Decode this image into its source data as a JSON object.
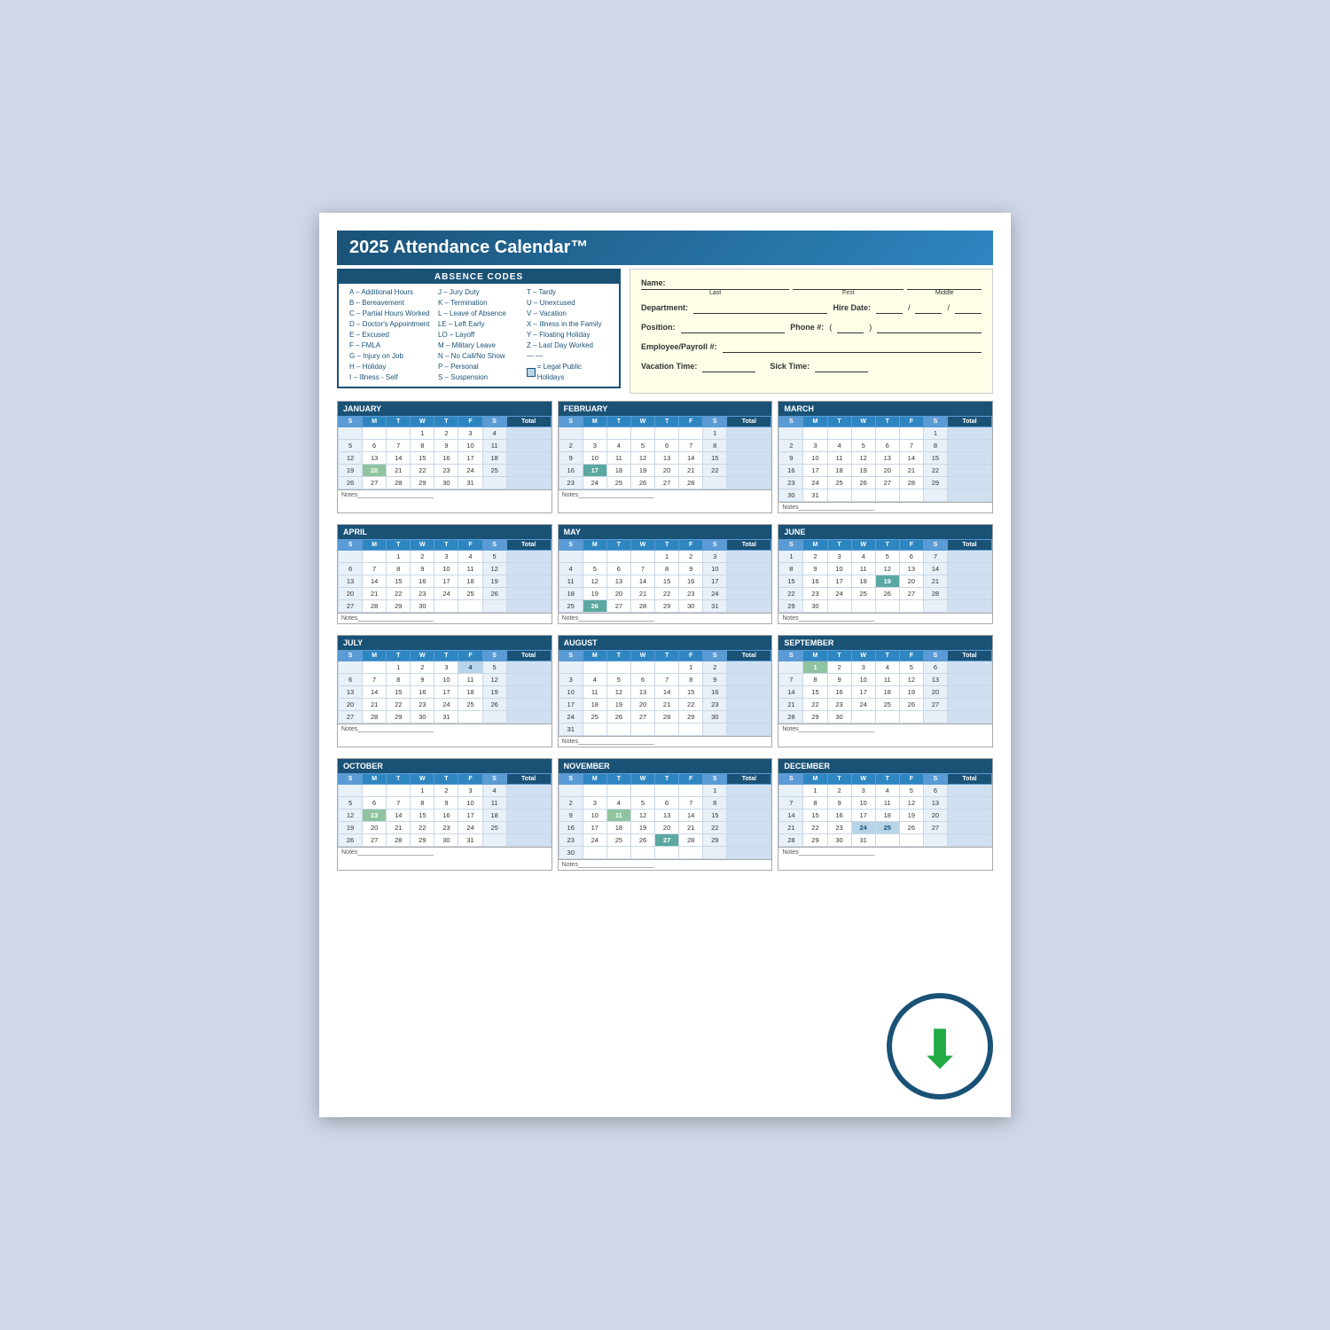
{
  "title": "2025 Attendance Calendar™",
  "absence_header": "ABSENCE CODES",
  "absence_codes_col1": [
    "A – Additional Hours",
    "B – Bereavement",
    "C – Partial Hours Worked",
    "D – Doctor's Appointment",
    "E – Excused",
    "F – FMLA",
    "G – Injury on Job",
    "H – Holiday",
    "I – Illness - Self"
  ],
  "absence_codes_col2": [
    "J – Jury Duty",
    "K – Termination",
    "L – Leave of Absence",
    "LE – Left Early",
    "LO – Layoff",
    "M – Military Leave",
    "N – No Call/No Show",
    "P – Personal",
    "S – Suspension"
  ],
  "absence_codes_col3": [
    "T – Tardy",
    "U – Unexcused",
    "V – Vacation",
    "X – Illness in the Family",
    "Y – Floating Holiday",
    "Z – Last Day Worked",
    "— —",
    "— = Legal Public Holidays"
  ],
  "employee_fields": {
    "name_label": "Name:",
    "last_label": "Last",
    "first_label": "First",
    "middle_label": "Middle",
    "dept_label": "Department:",
    "hire_label": "Hire Date:",
    "position_label": "Position:",
    "phone_label": "Phone #:",
    "emp_label": "Employee/Payroll #:",
    "vacation_label": "Vacation Time:",
    "sick_label": "Sick Time:"
  },
  "months": [
    {
      "name": "JANUARY",
      "days": [
        [
          "",
          "",
          "",
          "1",
          "2",
          "3",
          "4"
        ],
        [
          "5",
          "6",
          "7",
          "8",
          "9",
          "10",
          "11"
        ],
        [
          "12",
          "13",
          "14",
          "15",
          "16",
          "17",
          "18"
        ],
        [
          "19",
          "20h",
          "21",
          "22",
          "23",
          "24",
          "25"
        ],
        [
          "26",
          "27",
          "28",
          "29",
          "30",
          "31",
          ""
        ]
      ]
    },
    {
      "name": "FEBRUARY",
      "days": [
        [
          "",
          "",
          "",
          "",
          "",
          "",
          "1"
        ],
        [
          "2",
          "3",
          "4",
          "5",
          "6",
          "7",
          "8"
        ],
        [
          "9",
          "10",
          "11",
          "12",
          "13",
          "14",
          "15"
        ],
        [
          "16",
          "17h",
          "18",
          "19",
          "20",
          "21",
          "22"
        ],
        [
          "23",
          "24",
          "25",
          "26",
          "27",
          "28",
          ""
        ]
      ]
    },
    {
      "name": "MARCH",
      "days": [
        [
          "",
          "",
          "",
          "",
          "",
          "",
          "1"
        ],
        [
          "2",
          "3",
          "4",
          "5",
          "6",
          "7",
          "8"
        ],
        [
          "9",
          "10",
          "11",
          "12",
          "13",
          "14",
          "15"
        ],
        [
          "16",
          "17",
          "18",
          "19",
          "20",
          "21",
          "22"
        ],
        [
          "23",
          "24",
          "25",
          "26",
          "27",
          "28",
          "29"
        ],
        [
          "30",
          "31",
          "",
          "",
          "",
          "",
          ""
        ]
      ]
    },
    {
      "name": "APRIL",
      "days": [
        [
          "",
          "",
          "1",
          "2",
          "3",
          "4",
          "5"
        ],
        [
          "6",
          "7",
          "8",
          "9",
          "10",
          "11",
          "12"
        ],
        [
          "13",
          "14",
          "15",
          "16",
          "17",
          "18",
          "19"
        ],
        [
          "20",
          "21",
          "22",
          "23",
          "24",
          "25",
          "26"
        ],
        [
          "27",
          "28",
          "29",
          "30",
          "",
          "",
          ""
        ]
      ]
    },
    {
      "name": "MAY",
      "days": [
        [
          "",
          "",
          "",
          "",
          "1",
          "2",
          "3"
        ],
        [
          "4",
          "5",
          "6",
          "7",
          "8",
          "9",
          "10"
        ],
        [
          "11",
          "12",
          "13",
          "14",
          "15",
          "16",
          "17"
        ],
        [
          "18",
          "19",
          "20",
          "21",
          "22",
          "23",
          "24"
        ],
        [
          "25",
          "26h",
          "27",
          "28",
          "29",
          "30",
          "31"
        ]
      ]
    },
    {
      "name": "JUNE",
      "days": [
        [
          "1",
          "2",
          "3",
          "4",
          "5",
          "6",
          "7"
        ],
        [
          "8",
          "9",
          "10",
          "11",
          "12",
          "13",
          "14"
        ],
        [
          "15",
          "16",
          "17",
          "18",
          "19h",
          "20",
          "21"
        ],
        [
          "22",
          "23",
          "24",
          "25",
          "26",
          "27",
          "28"
        ],
        [
          "29",
          "30",
          "",
          "",
          "",
          "",
          ""
        ]
      ]
    },
    {
      "name": "JULY",
      "days": [
        [
          "",
          "",
          "1",
          "2",
          "3",
          "4h",
          "5"
        ],
        [
          "6",
          "7",
          "8",
          "9",
          "10",
          "11",
          "12"
        ],
        [
          "13",
          "14",
          "15",
          "16",
          "17",
          "18",
          "19"
        ],
        [
          "20",
          "21",
          "22",
          "23",
          "24",
          "25",
          "26"
        ],
        [
          "27",
          "28",
          "29",
          "30",
          "31",
          "",
          ""
        ]
      ]
    },
    {
      "name": "AUGUST",
      "days": [
        [
          "",
          "",
          "",
          "",
          "",
          "1",
          "2"
        ],
        [
          "3",
          "4",
          "5",
          "6",
          "7",
          "8",
          "9"
        ],
        [
          "10",
          "11",
          "12",
          "13",
          "14",
          "15",
          "16"
        ],
        [
          "17",
          "18",
          "19",
          "20",
          "21",
          "22",
          "23"
        ],
        [
          "24",
          "25",
          "26",
          "27",
          "28",
          "29",
          "30"
        ],
        [
          "31",
          "",
          "",
          "",
          "",
          "",
          ""
        ]
      ]
    },
    {
      "name": "SEPTEMBER",
      "days": [
        [
          "",
          "1h",
          "2",
          "3",
          "4",
          "5",
          "6"
        ],
        [
          "7",
          "8",
          "9",
          "10",
          "11",
          "12",
          "13"
        ],
        [
          "14",
          "15",
          "16",
          "17",
          "18",
          "19",
          "20"
        ],
        [
          "21",
          "22",
          "23",
          "24",
          "25",
          "26",
          "27"
        ],
        [
          "28",
          "29",
          "30",
          "",
          "",
          "",
          ""
        ]
      ]
    },
    {
      "name": "OCTOBER",
      "days": [
        [
          "",
          "",
          "",
          "1",
          "2",
          "3",
          "4"
        ],
        [
          "5",
          "6",
          "7",
          "8",
          "9",
          "10",
          "11"
        ],
        [
          "12",
          "13h",
          "14",
          "15",
          "16",
          "17",
          "18"
        ],
        [
          "19",
          "20",
          "21",
          "22",
          "23",
          "24",
          "25"
        ],
        [
          "26",
          "27",
          "28",
          "29",
          "30",
          "31",
          ""
        ]
      ]
    },
    {
      "name": "NOVEMBER",
      "days": [
        [
          "",
          "",
          "",
          "",
          "",
          "",
          "1"
        ],
        [
          "2",
          "3",
          "4",
          "5",
          "6",
          "7",
          "8"
        ],
        [
          "9",
          "10",
          "11h",
          "12",
          "13",
          "14",
          "15"
        ],
        [
          "16",
          "17",
          "18",
          "19",
          "20",
          "21",
          "22"
        ],
        [
          "23",
          "24",
          "25",
          "26",
          "27h",
          "28",
          "29"
        ],
        [
          "30",
          "",
          "",
          "",
          "",
          "",
          ""
        ]
      ]
    },
    {
      "name": "DECEMBER",
      "days": [
        [
          "",
          "1",
          "2",
          "3",
          "4",
          "5",
          "6"
        ],
        [
          "7",
          "8",
          "9",
          "10",
          "11",
          "12",
          "13"
        ],
        [
          "14",
          "15",
          "16",
          "17",
          "18",
          "19",
          "20"
        ],
        [
          "21",
          "22",
          "23",
          "24h",
          "25h",
          "26",
          "27"
        ],
        [
          "28",
          "29",
          "30",
          "31",
          "",
          "",
          ""
        ]
      ]
    }
  ],
  "notes_label": "Notes",
  "days_header": [
    "S",
    "M",
    "T",
    "W",
    "T",
    "F",
    "S",
    "Total"
  ]
}
